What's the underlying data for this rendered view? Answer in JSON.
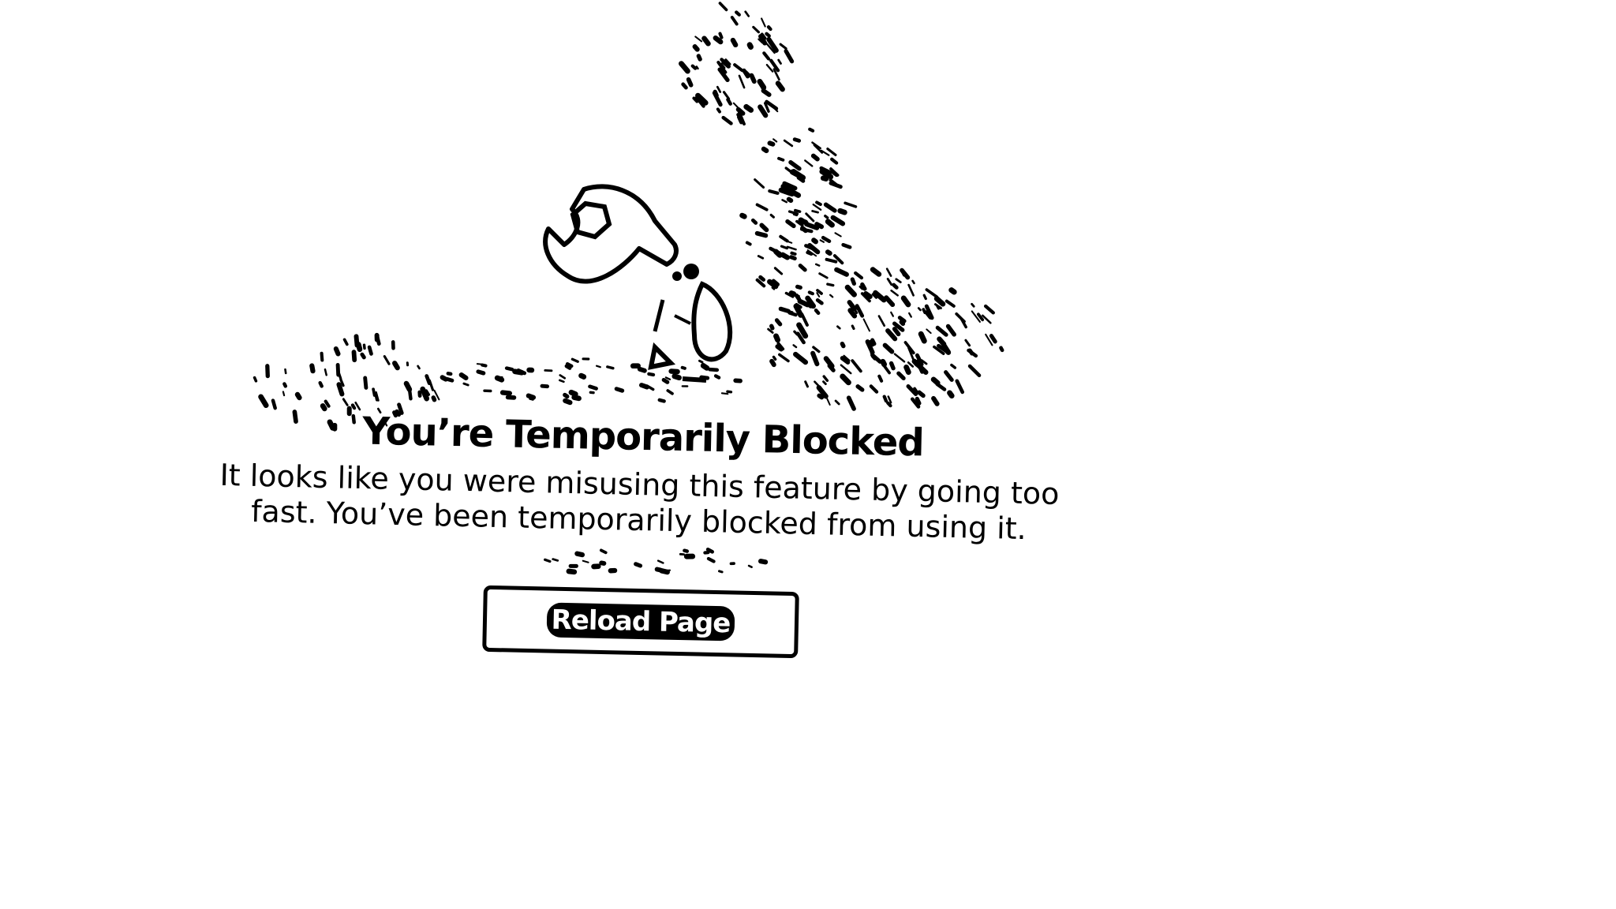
{
  "error": {
    "title": "You’re Temporarily Blocked",
    "message": "It looks like you were misusing this feature by going too fast. You’ve been temporarily blocked from using it."
  },
  "actions": {
    "reload_label": "Reload Page"
  },
  "illustration": {
    "icon": "wrench-robot-icon"
  },
  "colors": {
    "background": "#ffffff",
    "foreground": "#000000"
  }
}
